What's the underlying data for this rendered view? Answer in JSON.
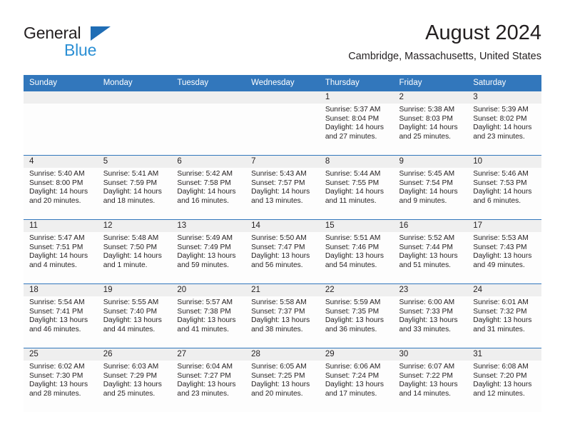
{
  "brand": {
    "name_part1": "General",
    "name_part2": "Blue",
    "triangle_icon": "triangle-icon",
    "accent_blue": "#2b8fd4",
    "logo_triangle_blue": "#1f6db5"
  },
  "header": {
    "title": "August 2024",
    "subtitle": "Cambridge, Massachusetts, United States"
  },
  "calendar": {
    "header_bg": "#3277bc",
    "header_text_color": "#ffffff",
    "daynum_band_bg": "#efefef",
    "row_divider_color": "#3277bc",
    "weekdays": [
      "Sunday",
      "Monday",
      "Tuesday",
      "Wednesday",
      "Thursday",
      "Friday",
      "Saturday"
    ],
    "weeks": [
      [
        {
          "day": "",
          "lines": []
        },
        {
          "day": "",
          "lines": []
        },
        {
          "day": "",
          "lines": []
        },
        {
          "day": "",
          "lines": []
        },
        {
          "day": "1",
          "lines": [
            "Sunrise: 5:37 AM",
            "Sunset: 8:04 PM",
            "Daylight: 14 hours",
            "and 27 minutes."
          ]
        },
        {
          "day": "2",
          "lines": [
            "Sunrise: 5:38 AM",
            "Sunset: 8:03 PM",
            "Daylight: 14 hours",
            "and 25 minutes."
          ]
        },
        {
          "day": "3",
          "lines": [
            "Sunrise: 5:39 AM",
            "Sunset: 8:02 PM",
            "Daylight: 14 hours",
            "and 23 minutes."
          ]
        }
      ],
      [
        {
          "day": "4",
          "lines": [
            "Sunrise: 5:40 AM",
            "Sunset: 8:00 PM",
            "Daylight: 14 hours",
            "and 20 minutes."
          ]
        },
        {
          "day": "5",
          "lines": [
            "Sunrise: 5:41 AM",
            "Sunset: 7:59 PM",
            "Daylight: 14 hours",
            "and 18 minutes."
          ]
        },
        {
          "day": "6",
          "lines": [
            "Sunrise: 5:42 AM",
            "Sunset: 7:58 PM",
            "Daylight: 14 hours",
            "and 16 minutes."
          ]
        },
        {
          "day": "7",
          "lines": [
            "Sunrise: 5:43 AM",
            "Sunset: 7:57 PM",
            "Daylight: 14 hours",
            "and 13 minutes."
          ]
        },
        {
          "day": "8",
          "lines": [
            "Sunrise: 5:44 AM",
            "Sunset: 7:55 PM",
            "Daylight: 14 hours",
            "and 11 minutes."
          ]
        },
        {
          "day": "9",
          "lines": [
            "Sunrise: 5:45 AM",
            "Sunset: 7:54 PM",
            "Daylight: 14 hours",
            "and 9 minutes."
          ]
        },
        {
          "day": "10",
          "lines": [
            "Sunrise: 5:46 AM",
            "Sunset: 7:53 PM",
            "Daylight: 14 hours",
            "and 6 minutes."
          ]
        }
      ],
      [
        {
          "day": "11",
          "lines": [
            "Sunrise: 5:47 AM",
            "Sunset: 7:51 PM",
            "Daylight: 14 hours",
            "and 4 minutes."
          ]
        },
        {
          "day": "12",
          "lines": [
            "Sunrise: 5:48 AM",
            "Sunset: 7:50 PM",
            "Daylight: 14 hours",
            "and 1 minute."
          ]
        },
        {
          "day": "13",
          "lines": [
            "Sunrise: 5:49 AM",
            "Sunset: 7:49 PM",
            "Daylight: 13 hours",
            "and 59 minutes."
          ]
        },
        {
          "day": "14",
          "lines": [
            "Sunrise: 5:50 AM",
            "Sunset: 7:47 PM",
            "Daylight: 13 hours",
            "and 56 minutes."
          ]
        },
        {
          "day": "15",
          "lines": [
            "Sunrise: 5:51 AM",
            "Sunset: 7:46 PM",
            "Daylight: 13 hours",
            "and 54 minutes."
          ]
        },
        {
          "day": "16",
          "lines": [
            "Sunrise: 5:52 AM",
            "Sunset: 7:44 PM",
            "Daylight: 13 hours",
            "and 51 minutes."
          ]
        },
        {
          "day": "17",
          "lines": [
            "Sunrise: 5:53 AM",
            "Sunset: 7:43 PM",
            "Daylight: 13 hours",
            "and 49 minutes."
          ]
        }
      ],
      [
        {
          "day": "18",
          "lines": [
            "Sunrise: 5:54 AM",
            "Sunset: 7:41 PM",
            "Daylight: 13 hours",
            "and 46 minutes."
          ]
        },
        {
          "day": "19",
          "lines": [
            "Sunrise: 5:55 AM",
            "Sunset: 7:40 PM",
            "Daylight: 13 hours",
            "and 44 minutes."
          ]
        },
        {
          "day": "20",
          "lines": [
            "Sunrise: 5:57 AM",
            "Sunset: 7:38 PM",
            "Daylight: 13 hours",
            "and 41 minutes."
          ]
        },
        {
          "day": "21",
          "lines": [
            "Sunrise: 5:58 AM",
            "Sunset: 7:37 PM",
            "Daylight: 13 hours",
            "and 38 minutes."
          ]
        },
        {
          "day": "22",
          "lines": [
            "Sunrise: 5:59 AM",
            "Sunset: 7:35 PM",
            "Daylight: 13 hours",
            "and 36 minutes."
          ]
        },
        {
          "day": "23",
          "lines": [
            "Sunrise: 6:00 AM",
            "Sunset: 7:33 PM",
            "Daylight: 13 hours",
            "and 33 minutes."
          ]
        },
        {
          "day": "24",
          "lines": [
            "Sunrise: 6:01 AM",
            "Sunset: 7:32 PM",
            "Daylight: 13 hours",
            "and 31 minutes."
          ]
        }
      ],
      [
        {
          "day": "25",
          "lines": [
            "Sunrise: 6:02 AM",
            "Sunset: 7:30 PM",
            "Daylight: 13 hours",
            "and 28 minutes."
          ]
        },
        {
          "day": "26",
          "lines": [
            "Sunrise: 6:03 AM",
            "Sunset: 7:29 PM",
            "Daylight: 13 hours",
            "and 25 minutes."
          ]
        },
        {
          "day": "27",
          "lines": [
            "Sunrise: 6:04 AM",
            "Sunset: 7:27 PM",
            "Daylight: 13 hours",
            "and 23 minutes."
          ]
        },
        {
          "day": "28",
          "lines": [
            "Sunrise: 6:05 AM",
            "Sunset: 7:25 PM",
            "Daylight: 13 hours",
            "and 20 minutes."
          ]
        },
        {
          "day": "29",
          "lines": [
            "Sunrise: 6:06 AM",
            "Sunset: 7:24 PM",
            "Daylight: 13 hours",
            "and 17 minutes."
          ]
        },
        {
          "day": "30",
          "lines": [
            "Sunrise: 6:07 AM",
            "Sunset: 7:22 PM",
            "Daylight: 13 hours",
            "and 14 minutes."
          ]
        },
        {
          "day": "31",
          "lines": [
            "Sunrise: 6:08 AM",
            "Sunset: 7:20 PM",
            "Daylight: 13 hours",
            "and 12 minutes."
          ]
        }
      ]
    ]
  }
}
